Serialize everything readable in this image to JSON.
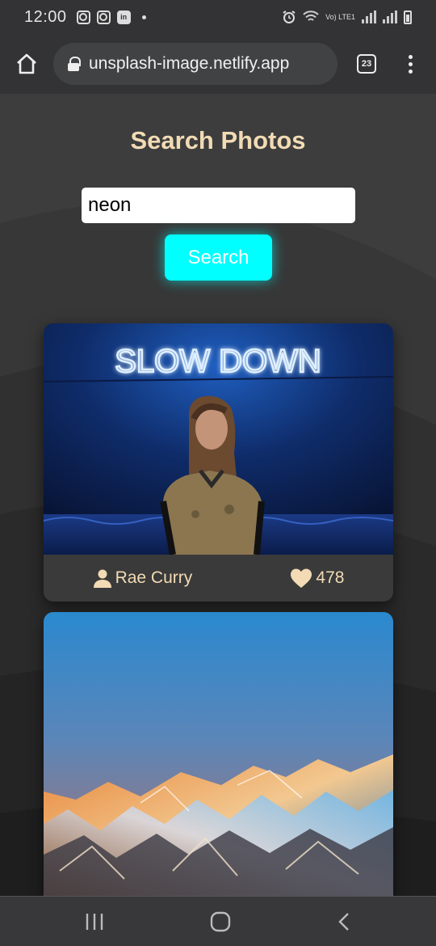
{
  "status_bar": {
    "time": "12:00",
    "network": "Vo) LTE1"
  },
  "browser": {
    "url": "unsplash-image.netlify.app",
    "tab_count": "23"
  },
  "page": {
    "title": "Search Photos",
    "search": {
      "value": "neon",
      "placeholder": ""
    },
    "search_button_label": "Search",
    "results": [
      {
        "image_text": "SLOW DOWN",
        "author": "Rae Curry",
        "likes": "478"
      },
      {
        "image_text": "",
        "author": "",
        "likes": ""
      }
    ]
  },
  "colors": {
    "accent": "#00FFFF",
    "title": "#F2DBB5",
    "background": "#3E3E3E"
  },
  "icons": [
    "home-icon",
    "lock-icon",
    "tabs-icon",
    "more-vert-icon",
    "user-icon",
    "heart-icon",
    "recents-icon",
    "home-nav-icon",
    "back-icon"
  ]
}
